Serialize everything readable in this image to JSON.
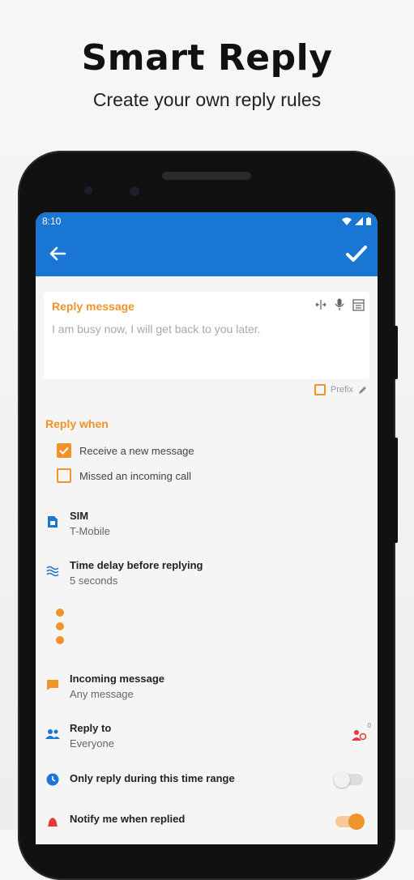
{
  "promo": {
    "title": "Smart Reply",
    "subtitle": "Create your own reply rules"
  },
  "status_bar": {
    "time": "8:10"
  },
  "app_bar": {
    "back_icon": "arrow-left-icon",
    "confirm_icon": "check-icon"
  },
  "reply_message": {
    "label": "Reply message",
    "text": "I am busy now, I will get back to you later.",
    "tools": [
      "text-cursor-icon",
      "mic-icon",
      "template-icon"
    ],
    "prefix_label": "Prefix",
    "prefix_checked": false
  },
  "reply_when": {
    "label": "Reply when",
    "options": [
      {
        "label": "Receive a new message",
        "checked": true
      },
      {
        "label": "Missed an incoming call",
        "checked": false
      }
    ]
  },
  "settings": {
    "sim": {
      "title": "SIM",
      "value": "T-Mobile",
      "icon": "sim-card-icon"
    },
    "delay": {
      "title": "Time delay before replying",
      "value": "5 seconds",
      "icon": "waves-icon"
    },
    "incoming": {
      "title": "Incoming message",
      "value": "Any message",
      "icon": "message-icon"
    },
    "reply_to": {
      "title": "Reply to",
      "value": "Everyone",
      "icon": "people-icon",
      "badge": "0"
    },
    "time_range": {
      "title": "Only reply during this time range",
      "icon": "clock-icon",
      "enabled": false
    },
    "notify": {
      "title": "Notify me when replied",
      "icon": "bell-icon",
      "enabled": true
    }
  },
  "colors": {
    "primary": "#1976d2",
    "accent": "#f0932b"
  }
}
